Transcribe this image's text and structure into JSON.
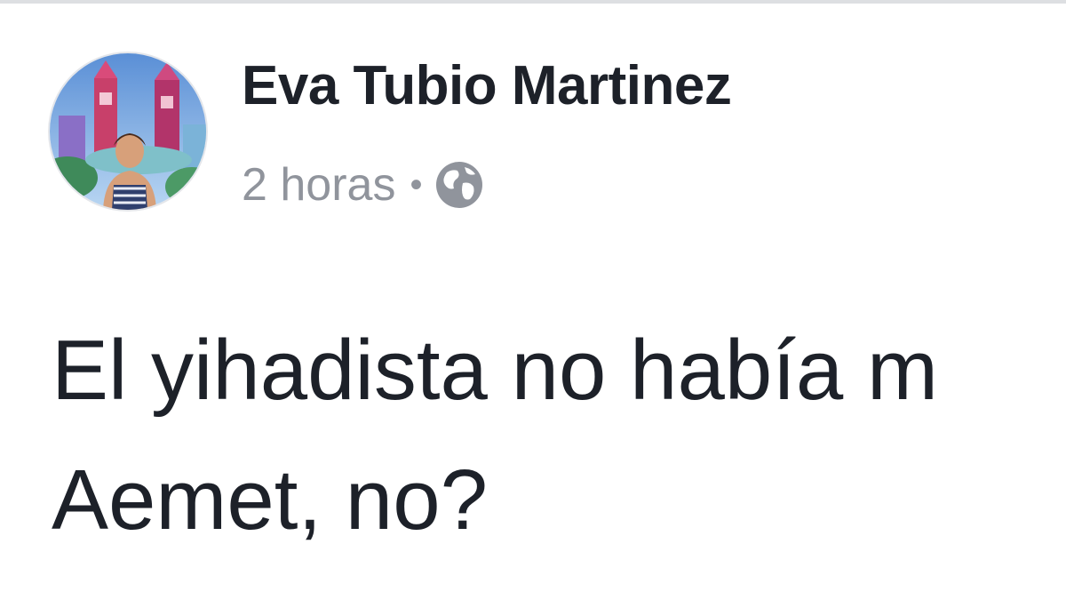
{
  "post": {
    "author_name": "Eva Tubio Martinez",
    "timestamp": "2 horas",
    "separator": "•",
    "privacy_icon": "globe-icon",
    "text_lines": [
      "El yihadista no había m",
      "Aemet, no?"
    ]
  },
  "colors": {
    "name": "#1d2129",
    "meta": "#90949c",
    "text": "#1d2129",
    "divider": "#dddfe2"
  }
}
